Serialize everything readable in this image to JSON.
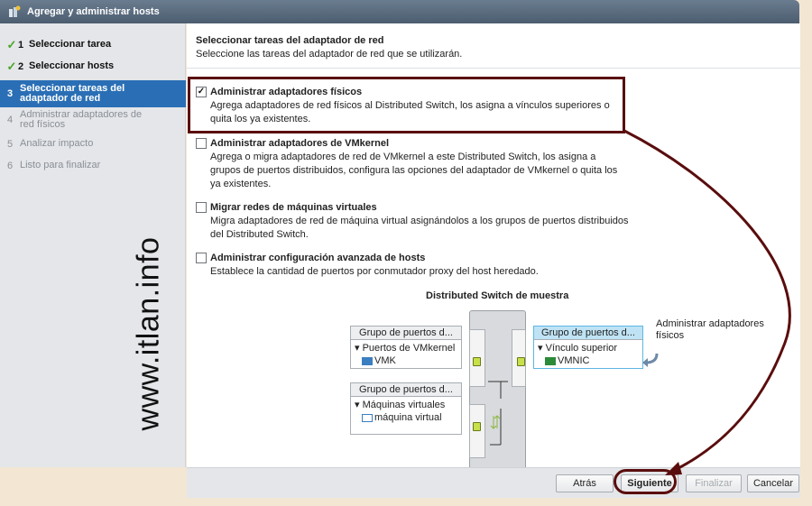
{
  "window": {
    "title": "Agregar y administrar hosts"
  },
  "steps": [
    {
      "num": "1",
      "label": "Seleccionar tarea",
      "state": "done"
    },
    {
      "num": "2",
      "label": "Seleccionar hosts",
      "state": "done"
    },
    {
      "num": "3",
      "label": "Seleccionar tareas del adaptador de red",
      "state": "current"
    },
    {
      "num": "4",
      "label": "Administrar adaptadores de red físicos",
      "state": "todo"
    },
    {
      "num": "5",
      "label": "Analizar impacto",
      "state": "todo"
    },
    {
      "num": "6",
      "label": "Listo para finalizar",
      "state": "todo"
    }
  ],
  "watermark": "www.itlan.info",
  "header": {
    "title": "Seleccionar tareas del adaptador de red",
    "subtitle": "Seleccione las tareas del adaptador de red que se utilizarán."
  },
  "options": [
    {
      "label": "Administrar adaptadores físicos",
      "checked": true,
      "desc": "Agrega adaptadores de red físicos al Distributed Switch, los asigna a vínculos superiores o quita los ya existentes."
    },
    {
      "label": "Administrar adaptadores de VMkernel",
      "checked": false,
      "desc": "Agrega o migra adaptadores de red de VMkernel a este Distributed Switch, los asigna a grupos de puertos distribuidos, configura las opciones del adaptador de VMkernel o quita los ya existentes."
    },
    {
      "label": "Migrar redes de máquinas virtuales",
      "checked": false,
      "desc": "Migra adaptadores de red de máquina virtual asignándolos a los grupos de puertos distribuidos del Distributed Switch."
    },
    {
      "label": "Administrar configuración avanzada de hosts",
      "checked": false,
      "desc": "Establece la cantidad de puertos por conmutador proxy del host heredado."
    }
  ],
  "diagram": {
    "title": "Distributed Switch de muestra",
    "pg_vmk": {
      "head": "Grupo de puertos d...",
      "sub": "Puertos de VMkernel",
      "item": "VMK"
    },
    "pg_vm": {
      "head": "Grupo de puertos d...",
      "sub": "Máquinas virtuales",
      "item": "máquina virtual"
    },
    "pg_uplink": {
      "head": "Grupo de puertos d...",
      "sub": "Vínculo superior",
      "item": "VMNIC"
    },
    "side_label": "Administrar adaptadores físicos"
  },
  "buttons": {
    "back": "Atrás",
    "next": "Siguiente",
    "finish": "Finalizar",
    "cancel": "Cancelar"
  },
  "colors": {
    "annotation": "#5a0d0d",
    "current_step": "#2a6fb5",
    "done_check": "#4aa526"
  }
}
